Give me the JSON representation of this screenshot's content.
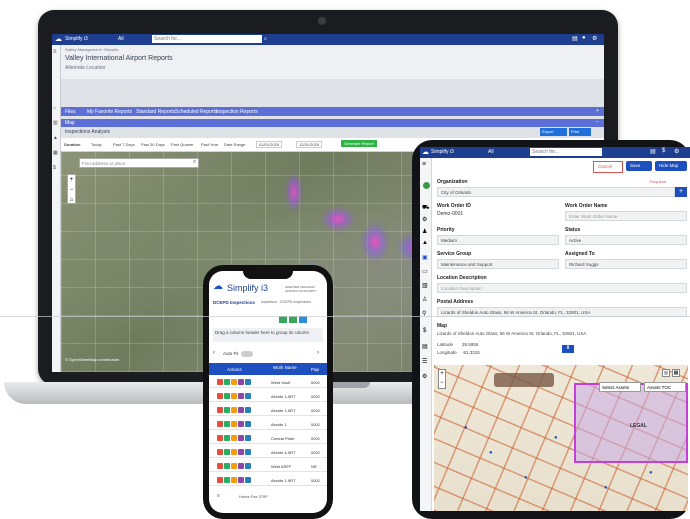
{
  "laptop": {
    "topbar": {
      "app_name": "Simplify i3",
      "scope": "All",
      "search_placeholder": "Search for..."
    },
    "header": {
      "breadcrumb": "Safety Management › Reports",
      "title": "Valley International Airport Reports",
      "subtitle": "Alternate Location"
    },
    "tabs": [
      "Files",
      "My Favorite Reports",
      "Standard Reports",
      "Scheduled Reports",
      "Inspection Reports"
    ],
    "subtab": "Map",
    "section_title": "Inspections Analysis",
    "toolbar": {
      "duration_label": "Duration",
      "options": [
        "Today",
        "Past 7 Days",
        "Past 30 Days",
        "Past Quarter",
        "Past Year",
        "Date Range"
      ],
      "date_from": "01/01/2020",
      "date_to": "12/31/2020",
      "generate_label": "Generate Report",
      "export_label": "Export",
      "print_label": "Print"
    },
    "map": {
      "search_placeholder": "Find address or place",
      "buttons": [
        "Select Map",
        "Layers",
        "Legend",
        "Tools"
      ]
    },
    "footer": "© OpenStreetMap contributors"
  },
  "tablet": {
    "topbar": {
      "app_name": "Simplify i3",
      "scope": "All",
      "search_placeholder": "Search for..."
    },
    "actions": {
      "cancel": "Cancel",
      "save": "Save",
      "hide_map": "Hide Map",
      "required": "Required"
    },
    "fields": {
      "organization_label": "Organization",
      "organization_value": "City of Orlando",
      "work_order_id_label": "Work Order ID",
      "work_order_id_value": "Demo-0001",
      "work_order_name_label": "Work Order Name",
      "work_order_name_placeholder": "Enter Work Order Name",
      "priority_label": "Priority",
      "priority_value": "Medium",
      "status_label": "Status",
      "status_value": "Active",
      "service_group_label": "Service Group",
      "service_group_value": "Maintenance and Support",
      "assigned_to_label": "Assigned To",
      "assigned_to_value": "Richard Suggs",
      "location_desc_label": "Location Description",
      "location_desc_placeholder": "Location Description",
      "postal_address_label": "Postal Address",
      "postal_address_value": "Lizards of Sheldon Auto Glass, 56 W America St, Orlando, FL, 32801, USA"
    },
    "map": {
      "label": "Map",
      "address": "Lizards of Sheldon Auto Glass, 56 W America St, Orlando, FL, 32801, USA",
      "latitude_label": "Latitude",
      "latitude_value": "28.5955",
      "longitude_label": "Longitude",
      "longitude_value": "-81.3315",
      "select_assets": "Select Assets",
      "assets_toc": "Assets TOC",
      "area_label": "LEGAL"
    }
  },
  "phone": {
    "logo": "Simplify i3",
    "org_badge": "GREATER ORLANDO AVIATION AUTHORITY",
    "breadcrumb_left": "DCEPD Inspections",
    "breadcrumb_right": "Inspection - DCEPD Inspections",
    "group_hint": "Drag a column header here to group its column",
    "autofit_label": "Auto Fit",
    "columns": [
      "Actions",
      "Work Name",
      "Pap"
    ],
    "rows": [
      {
        "name": "West Vault",
        "code": "0002"
      },
      {
        "name": "Airside 1 ART",
        "code": "0002"
      },
      {
        "name": "Airside 1 ART",
        "code": "0002"
      },
      {
        "name": "Airside 1",
        "code": "0002"
      },
      {
        "name": "Central Plant",
        "code": "0002"
      },
      {
        "name": "Airside 4 ART",
        "code": "0002"
      },
      {
        "name": "West ARFF",
        "code": "NR"
      },
      {
        "name": "Airside 1 ART",
        "code": "0002"
      }
    ],
    "footer": "Home Fax 370P"
  }
}
